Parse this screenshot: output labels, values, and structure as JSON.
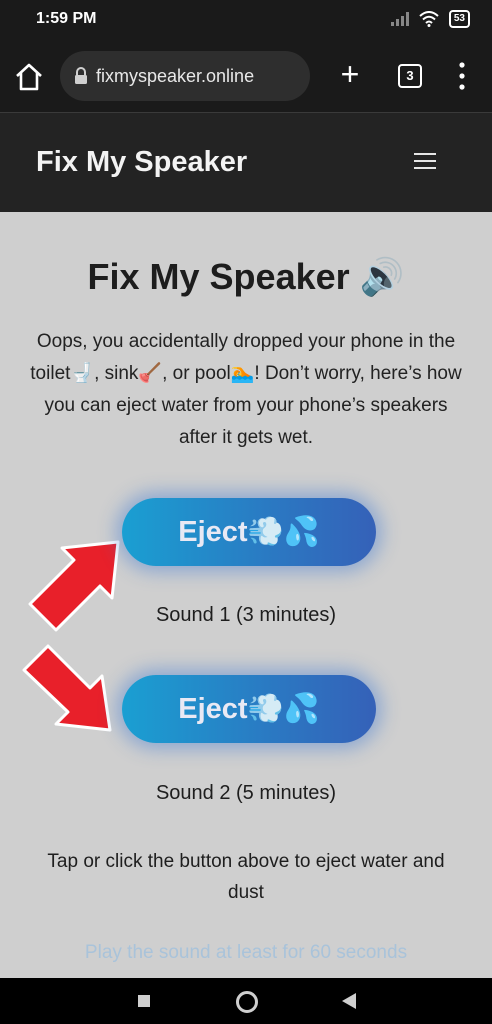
{
  "status_bar": {
    "time": "1:59 PM",
    "battery": "53"
  },
  "browser": {
    "url": "fixmyspeaker.online",
    "tab_count": "3",
    "new_tab": "+"
  },
  "site": {
    "title": "Fix My Speaker"
  },
  "main": {
    "title": "Fix My Speaker 🔊",
    "intro": "Oops, you accidentally dropped your phone in the toilet🚽, sink🪠, or pool🏊! Don’t worry, here’s how you can eject water from your phone’s speakers after it gets wet.",
    "buttons": [
      {
        "label": "Eject💨💦",
        "caption": "Sound 1 (3 minutes)"
      },
      {
        "label": "Eject💨💦",
        "caption": "Sound 2 (5 minutes)"
      }
    ],
    "instruction": "Tap or click the button above to eject water and dust",
    "hint": "Play the sound at least for 60 seconds"
  },
  "colors": {
    "arrow": "#e8202a",
    "button_start": "#1a9fd2",
    "button_end": "#3561b8",
    "hint": "#a9c3da"
  }
}
